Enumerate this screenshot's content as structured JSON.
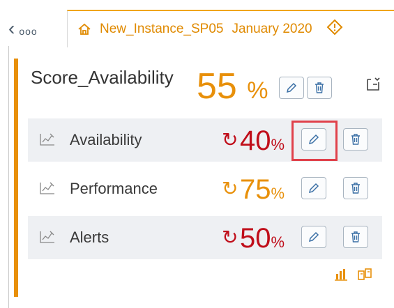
{
  "header": {
    "back_chevron": "‹",
    "back_dots": "ooo",
    "instance_name": "New_Instance_SP05",
    "period": "January 2020",
    "warning_icon": "warning-diamond-icon"
  },
  "card": {
    "title": "Score_Availability",
    "score_value": "55",
    "score_unit": "%"
  },
  "rows": [
    {
      "label": "Availability",
      "value": "40",
      "unit": "%",
      "trend": "down",
      "color": "#c00e1a",
      "trend_glyph": "↻"
    },
    {
      "label": "Performance",
      "value": "75",
      "unit": "%",
      "trend": "up",
      "color": "#e8900a",
      "trend_glyph": "↻"
    },
    {
      "label": "Alerts",
      "value": "50",
      "unit": "%",
      "trend": "down",
      "color": "#c00e1a",
      "trend_glyph": "↻"
    }
  ],
  "colors": {
    "accent": "#e8900a",
    "alert_red": "#c00e1a",
    "highlight": "#e0404a"
  }
}
